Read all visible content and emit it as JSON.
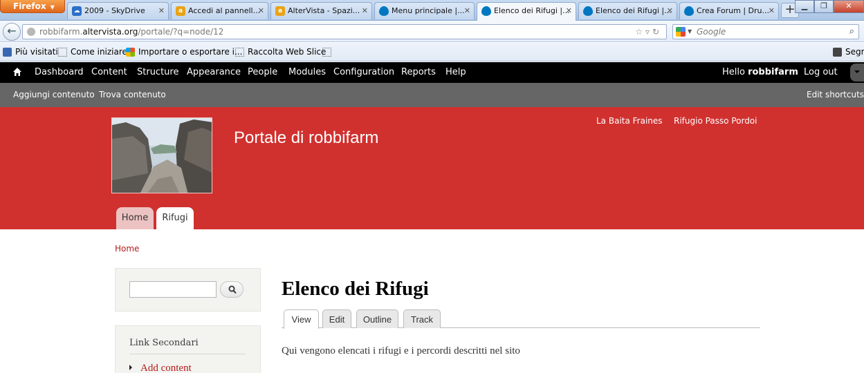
{
  "browser": {
    "menu_button": "Firefox",
    "tabs": [
      {
        "label": "2009 - SkyDrive",
        "icon_color": "#2b6fc8",
        "icon_glyph": "☁",
        "active": false
      },
      {
        "label": "Accedi al pannell...",
        "icon_color": "#e8a317",
        "icon_glyph": "a",
        "active": false
      },
      {
        "label": "AlterVista - Spazi...",
        "icon_color": "#e8a317",
        "icon_glyph": "a",
        "active": false
      },
      {
        "label": "Menu principale |...",
        "icon_color": "#0077c0",
        "icon_glyph": "",
        "active": false
      },
      {
        "label": "Elenco dei Rifugi |...",
        "icon_color": "#0077c0",
        "icon_glyph": "",
        "active": true
      },
      {
        "label": "Elenco dei Rifugi |...",
        "icon_color": "#0077c0",
        "icon_glyph": "",
        "active": false
      },
      {
        "label": "Crea Forum | Dru...",
        "icon_color": "#0077c0",
        "icon_glyph": "",
        "active": false
      }
    ],
    "new_tab_label": "+",
    "url_prefix": "robbifarm.",
    "url_domain": "altervista.org",
    "url_path": "/portale/?q=node/12",
    "search_placeholder": "Google",
    "bookmarks": [
      "Più visitati",
      "Come iniziare",
      "Importare o esportare i...",
      "Raccolta Web Slice",
      "",
      "Segr"
    ]
  },
  "toolbar": {
    "items": [
      "Dashboard",
      "Content",
      "Structure",
      "Appearance",
      "People",
      "Modules",
      "Configuration",
      "Reports",
      "Help"
    ],
    "hello_prefix": "Hello ",
    "username": "robbifarm",
    "logout": "Log out"
  },
  "shortcuts": {
    "items": [
      "Aggiungi contenuto",
      "Trova contenuto"
    ],
    "edit": "Edit shortcuts"
  },
  "header": {
    "site_name": "Portale di robbifarm",
    "secondary_links": [
      "La Baita Fraines",
      "Rifugio Passo Pordoi"
    ],
    "main_tabs": [
      "Home",
      "Rifugi"
    ],
    "accent_color": "#d0312f"
  },
  "breadcrumb": "Home",
  "sidebar": {
    "nav_title": "Link Secondari",
    "nav_items": [
      "Add content"
    ]
  },
  "content": {
    "title": "Elenco dei Rifugi",
    "local_tabs": [
      "View",
      "Edit",
      "Outline",
      "Track"
    ],
    "body": "Qui vengono elencati i rifugi e i percordi descritti nel sito"
  }
}
